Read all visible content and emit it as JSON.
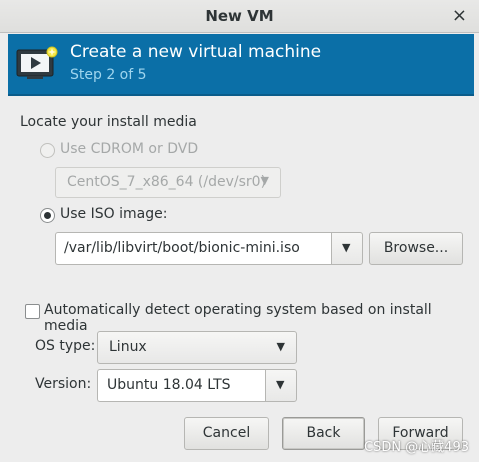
{
  "window": {
    "title": "New VM",
    "close_glyph": "×"
  },
  "banner": {
    "icon": "monitor-play-icon",
    "title": "Create a new virtual machine",
    "step": "Step 2 of 5",
    "accent": "#0b6fa7"
  },
  "media": {
    "section_label": "Locate your install media",
    "cdrom_label": "Use CDROM or DVD",
    "cdrom_value": "CentOS_7_x86_64 (/dev/sr0)",
    "iso_label": "Use ISO image:",
    "iso_path": "/var/lib/libvirt/boot/bionic-mini.iso",
    "browse_label": "Browse..."
  },
  "os": {
    "autodetect_label": "Automatically detect operating system based on install media",
    "type_label": "OS type:",
    "type_value": "Linux",
    "version_label": "Version:",
    "version_value": "Ubuntu 18.04 LTS"
  },
  "footer": {
    "cancel": "Cancel",
    "back": "Back",
    "forward": "Forward"
  },
  "watermark": "CSDN @心藏493"
}
